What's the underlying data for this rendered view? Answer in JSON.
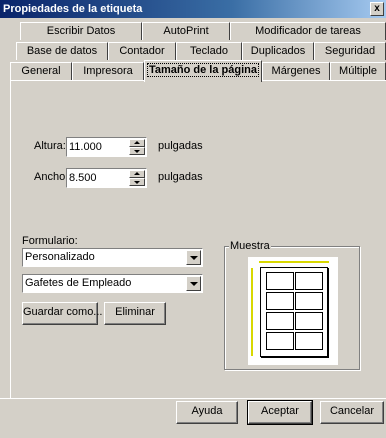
{
  "window": {
    "title": "Propiedades de la etiqueta",
    "close_glyph": "x"
  },
  "tabs": {
    "row1": [
      "Escribir Datos",
      "AutoPrint",
      "Modificador de tareas"
    ],
    "row2": [
      "Base de datos",
      "Contador",
      "Teclado",
      "Duplicados",
      "Seguridad"
    ],
    "row3": [
      "General",
      "Impresora",
      "Tamaño de la página",
      "Márgenes",
      "Múltiple"
    ],
    "active": "Tamaño de la página"
  },
  "size": {
    "height_label": "Altura:",
    "height_value": "11.000",
    "width_label": "Ancho:",
    "width_value": "8.500",
    "unit": "pulgadas"
  },
  "form": {
    "label": "Formulario:",
    "type_value": "Personalizado",
    "name_value": "Gafetes de Empleado",
    "save_as": "Guardar como...",
    "delete": "Eliminar"
  },
  "preview": {
    "title": "Muestra",
    "accent_color": "#d8d800"
  },
  "footer": {
    "help": "Ayuda",
    "accept": "Aceptar",
    "cancel": "Cancelar"
  }
}
